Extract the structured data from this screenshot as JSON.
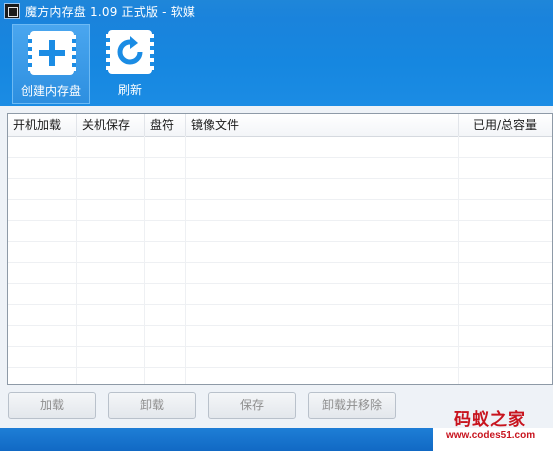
{
  "window": {
    "title": "魔方内存盘 1.09 正式版 - 软媒",
    "accent_color": "#1b8ce4"
  },
  "toolbar": {
    "create": {
      "label": "创建内存盘",
      "icon": "plus-icon"
    },
    "refresh": {
      "label": "刷新",
      "icon": "refresh-icon"
    }
  },
  "table": {
    "columns": [
      "开机加载",
      "关机保存",
      "盘符",
      "镜像文件",
      "已用/总容量"
    ],
    "rows": []
  },
  "buttons": {
    "load": "加载",
    "unload": "卸载",
    "save": "保存",
    "unload_remove": "卸载并移除"
  },
  "watermark": {
    "main": "码蚁之家",
    "sub": "www.codes51.com"
  }
}
